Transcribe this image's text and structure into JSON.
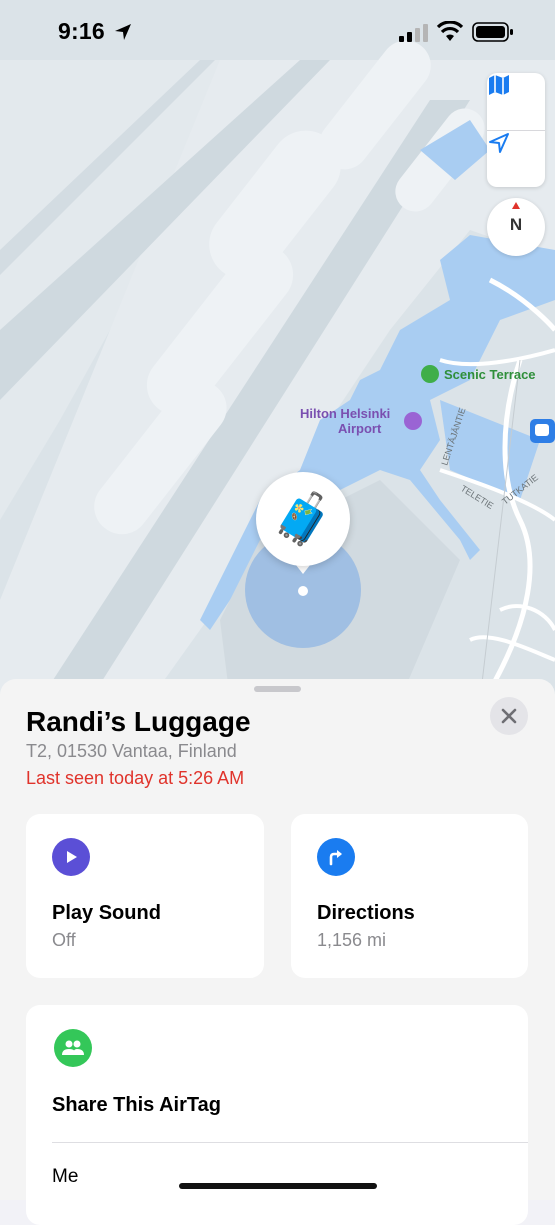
{
  "status_bar": {
    "time": "9:16"
  },
  "map": {
    "labels": {
      "scenic_terrace": "Scenic Terrace",
      "hilton_line1": "Hilton Helsinki",
      "hilton_line2": "Airport",
      "road_lentajantie": "LENTÄJÄNTIE",
      "road_teletie": "TELETIE",
      "road_tutkatie": "TUTKATIE"
    },
    "compass_label": "N",
    "pin_emoji": "🧳"
  },
  "sheet": {
    "title": "Randi’s Luggage",
    "address": "T2, 01530 Vantaa, Finland",
    "last_seen": "Last seen today at 5:26 AM",
    "actions": [
      {
        "label": "Play Sound",
        "sub": "Off",
        "color": "#5b4fd6",
        "icon": "play-icon"
      },
      {
        "label": "Directions",
        "sub": "1,156 mi",
        "color": "#1a7cf0",
        "icon": "turn-right-icon"
      }
    ],
    "share": {
      "label": "Share This AirTag",
      "icon": "people-icon",
      "color": "#34c759",
      "first_person": "Me"
    }
  },
  "colors": {
    "accent": "#1a7cf0",
    "alert": "#e0332b",
    "map_bg": "#dbe3e8",
    "terminal": "#a9cdf2"
  }
}
